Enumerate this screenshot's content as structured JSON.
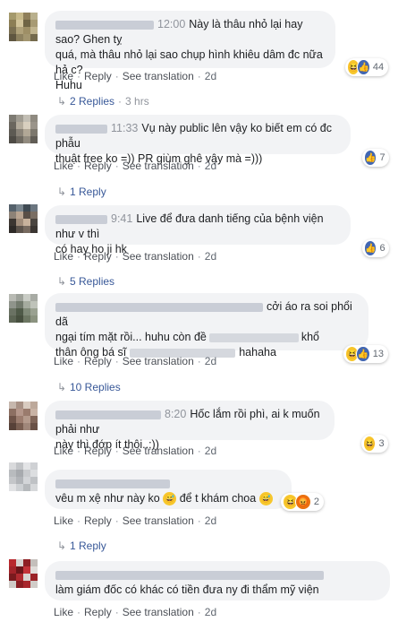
{
  "actions": {
    "like": "Like",
    "reply": "Reply",
    "translate": "See translation",
    "sep": "·"
  },
  "comments": [
    {
      "time": "12:00",
      "text_line1": "Này là thâu nhỏ lại hay sao? Ghen tỵ",
      "text_line2": "quá, mà thâu nhỏ lại sao chụp hình khiêu dâm đc nữa hả c?",
      "text_line3": "Huhu",
      "age": "2d",
      "reaction_count": "44",
      "replies": "2 Replies",
      "replies_time": "3 hrs"
    },
    {
      "time": "11:33",
      "text_line1": "Vụ này public lên vậy ko biết em có đc phẫu",
      "text_line2": "thuật free ko =)) PR giùm ghê vậy mà =)))",
      "age": "2d",
      "reaction_count": "7",
      "replies": "1 Reply"
    },
    {
      "time": "9:41",
      "text_line1": "Live để đưa danh tiếng của bệnh viện như v thì",
      "text_line2": "có hay ho ji hk",
      "age": "2d",
      "reaction_count": "6",
      "replies": "5 Replies"
    },
    {
      "text_line1": "cởi áo ra soi phổi dã",
      "text_line2": "ngại tím mặt rồi... huhu còn đề",
      "text_line2b": "khổ",
      "text_line3a": "thân ông bá sĩ",
      "text_line3b": "hahaha",
      "age": "2d",
      "reaction_count": "13",
      "replies": "10 Replies"
    },
    {
      "time": "8:20",
      "text_line1": "Hốc lắm rồi phì, ai k muốn phải như",
      "text_line2": "này thì đớp ít thôi..:))",
      "age": "2d",
      "reaction_count": "3",
      "replies": "1 Reply"
    },
    {
      "text_line1a": "vêu m xệ như này ko",
      "text_line1b": "để t khám choa",
      "age": "2d",
      "reaction_count": "2",
      "replies": "1 Reply"
    },
    {
      "text_line1": "làm giám đốc có khác có tiền đưa ny đi thẩm mỹ viện",
      "age": "2d"
    }
  ]
}
